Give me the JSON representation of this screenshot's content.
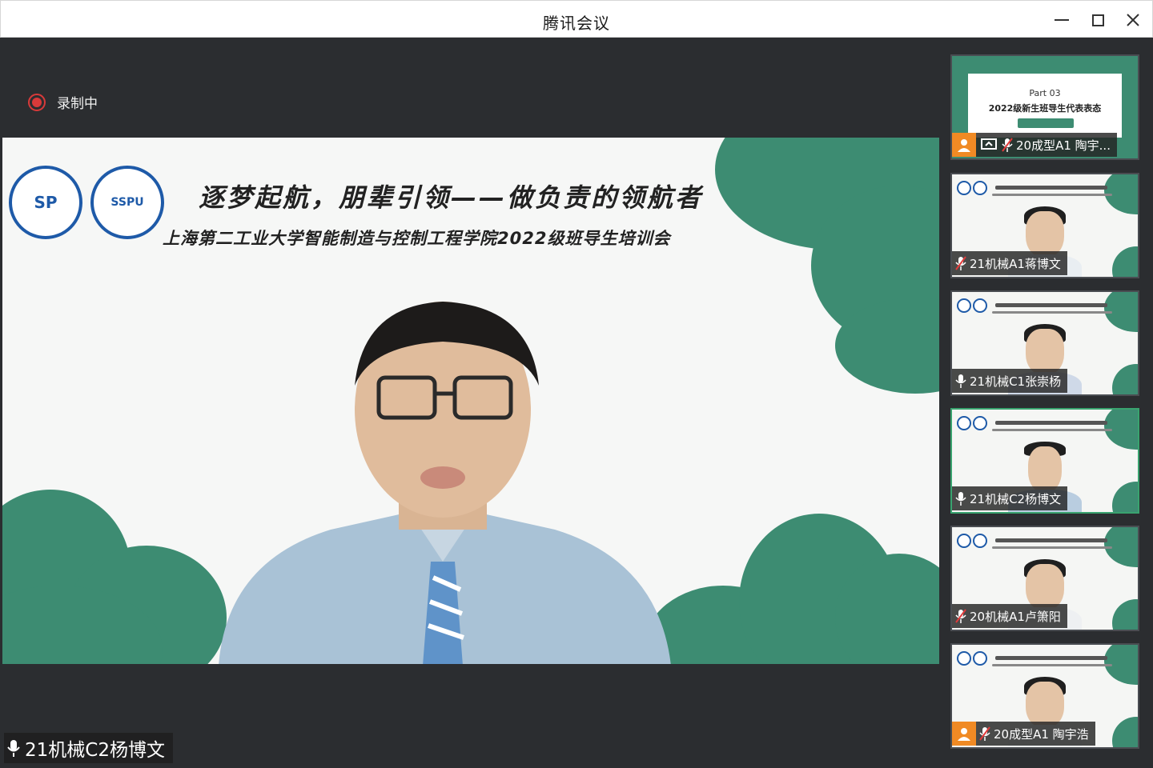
{
  "window": {
    "title": "腾讯会议"
  },
  "recording": {
    "label": "录制中"
  },
  "main_video": {
    "speaker_name": "21机械C2杨博文",
    "banner_title": "逐梦起航，朋辈引领——做负责的领航者",
    "banner_subtitle": "上海第二工业大学智能制造与控制工程学院2022级班导生培训会",
    "logo1_text": "SP",
    "logo2_text": "SSPU"
  },
  "participants": [
    {
      "name": "20成型A1 陶宇...",
      "mic": "muted",
      "camera_off": true,
      "sharing": true,
      "slide_part": "Part 03",
      "slide_title": "2022级新生班导生代表表态"
    },
    {
      "name": "21机械A1蒋博文",
      "mic": "muted",
      "camera_off": false,
      "sharing": false
    },
    {
      "name": "21机械C1张崇杨",
      "mic": "on",
      "camera_off": false,
      "sharing": false
    },
    {
      "name": "21机械C2杨博文",
      "mic": "on",
      "camera_off": false,
      "sharing": false,
      "active": true
    },
    {
      "name": "20机械A1卢箫阳",
      "mic": "muted",
      "camera_off": false,
      "sharing": false
    },
    {
      "name": "20成型A1 陶宇浩",
      "mic": "muted",
      "camera_off": true,
      "sharing": false
    }
  ],
  "colors": {
    "accent_green": "#3d8c72",
    "record_red": "#d83a3a",
    "camera_badge": "#f08a24",
    "active_border": "#39a36f"
  }
}
